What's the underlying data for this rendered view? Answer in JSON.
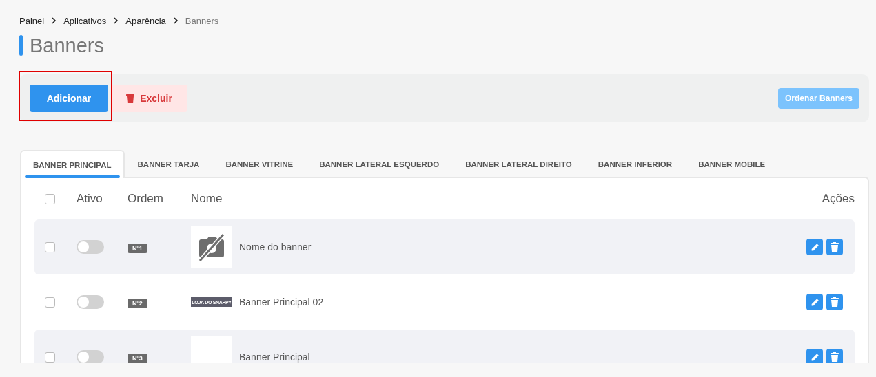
{
  "breadcrumb": [
    {
      "label": "Painel",
      "current": false
    },
    {
      "label": "Aplicativos",
      "current": false
    },
    {
      "label": "Aparência",
      "current": false
    },
    {
      "label": "Banners",
      "current": true
    }
  ],
  "page_title": "Banners",
  "toolbar": {
    "add_button": {
      "label": "Adicionar",
      "highlighted": true
    },
    "delete_button": {
      "label": "Excluir"
    },
    "sort_button": {
      "label": "Ordenar Banners",
      "disabled": true
    }
  },
  "tabs": [
    {
      "label": "BANNER PRINCIPAL",
      "selected": true
    },
    {
      "label": "BANNER TARJA",
      "selected": false
    },
    {
      "label": "BANNER VITRINE",
      "selected": false
    },
    {
      "label": "BANNER LATERAL ESQUERDO",
      "selected": false
    },
    {
      "label": "BANNER LATERAL DIREITO",
      "selected": false
    },
    {
      "label": "BANNER INFERIOR",
      "selected": false
    },
    {
      "label": "BANNER MOBILE",
      "selected": false
    }
  ],
  "table": {
    "select_all_checked": false,
    "columns": [
      "Ativo",
      "Ordem",
      "Nome",
      "Ações"
    ],
    "rows": [
      {
        "checked": false,
        "active": false,
        "order": "Nº1",
        "thumbnail": {
          "kind": "no-image"
        },
        "name": "Nome do banner"
      },
      {
        "checked": false,
        "active": false,
        "order": "Nº2",
        "thumbnail": {
          "kind": "logo",
          "text": "LOJA DO SNAPPY"
        },
        "name": "Banner Principal 02"
      },
      {
        "checked": false,
        "active": false,
        "order": "Nº3",
        "thumbnail": {
          "kind": "blank"
        },
        "name": "Banner Principal"
      }
    ]
  }
}
